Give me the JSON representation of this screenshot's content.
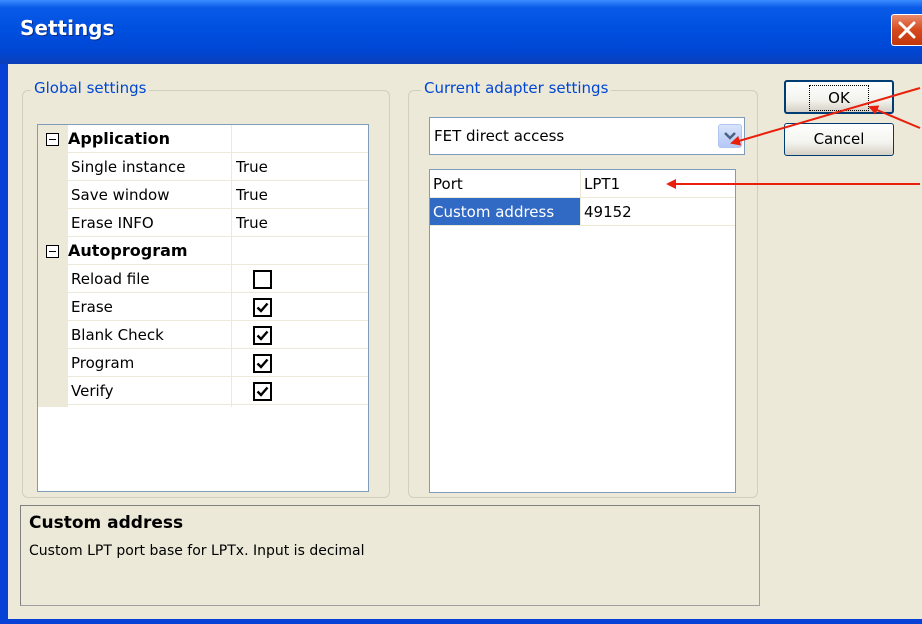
{
  "window": {
    "title": "Settings"
  },
  "global_settings": {
    "label": "Global settings",
    "categories": [
      {
        "name": "Application",
        "rows": [
          {
            "name": "Single instance",
            "value": "True"
          },
          {
            "name": "Save window",
            "value": "True"
          },
          {
            "name": "Erase INFO",
            "value": "True"
          }
        ]
      },
      {
        "name": "Autoprogram",
        "rows": [
          {
            "name": "Reload file",
            "checked": false
          },
          {
            "name": "Erase",
            "checked": true
          },
          {
            "name": "Blank Check",
            "checked": true
          },
          {
            "name": "Program",
            "checked": true
          },
          {
            "name": "Verify",
            "checked": true
          }
        ]
      }
    ]
  },
  "adapter_settings": {
    "label": "Current adapter settings",
    "adapter_select": {
      "value": "FET direct access",
      "icon": "chevron-down-icon"
    },
    "rows": [
      {
        "name": "Port",
        "value": "LPT1",
        "selected": false
      },
      {
        "name": "Custom address",
        "value": "49152",
        "selected": true
      }
    ]
  },
  "buttons": {
    "ok": "OK",
    "cancel": "Cancel"
  },
  "description": {
    "title": "Custom address",
    "text": "Custom LPT port base for LPTx. Input is decimal"
  },
  "colors": {
    "title_bar": "#0050e0",
    "dialog_face": "#ece9d8",
    "group_label": "#0046d5",
    "selection": "#316ac5",
    "annotation_arrow": "#e8200c"
  }
}
